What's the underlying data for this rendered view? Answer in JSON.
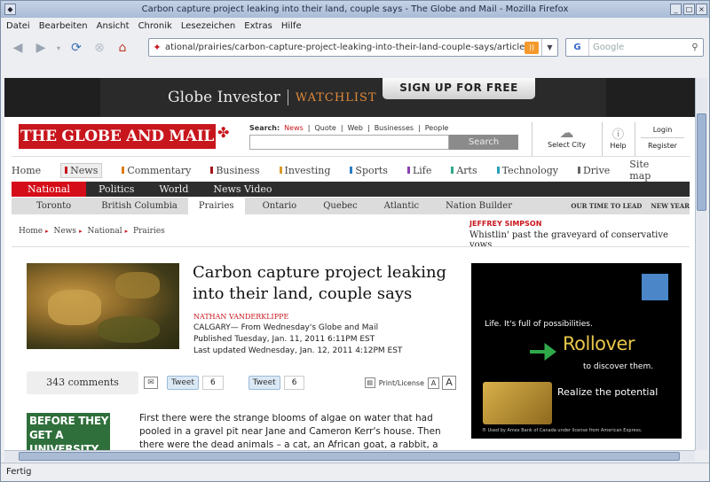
{
  "window": {
    "title": "Carbon capture project leaking into their land, couple says - The Globe and Mail - Mozilla Firefox"
  },
  "menu": [
    "Datei",
    "Bearbeiten",
    "Ansicht",
    "Chronik",
    "Lesezeichen",
    "Extras",
    "Hilfe"
  ],
  "url": "ational/prairies/carbon-capture-project-leaking-into-their-land-couple-says/article1866299/",
  "search_placeholder": "Google",
  "status": "Fertig",
  "ad_top": {
    "brand": "Globe Investor",
    "product": "WATCHLIST",
    "cta": "SIGN UP FOR FREE"
  },
  "site": {
    "logo": "THE GLOBE AND MAIL",
    "search_label": "Search:",
    "search_options": [
      "News",
      "Quote",
      "Web",
      "Businesses",
      "People"
    ],
    "search_button": "Search",
    "tools": {
      "city": "Select City",
      "help": "Help",
      "login": "Login",
      "register": "Register"
    }
  },
  "sections": [
    "Home",
    "News",
    "Commentary",
    "Business",
    "Investing",
    "Sports",
    "Life",
    "Arts",
    "Technology",
    "Drive",
    "Site map"
  ],
  "subnav": [
    "National",
    "Politics",
    "World",
    "News Video"
  ],
  "regions": [
    "Toronto",
    "British Columbia",
    "Prairies",
    "Ontario",
    "Quebec",
    "Atlantic",
    "Nation Builder"
  ],
  "regions_right": [
    "OUR TIME TO LEAD",
    "NEW YEAR"
  ],
  "breadcrumb": [
    "Home",
    "News",
    "National",
    "Prairies"
  ],
  "column": {
    "author": "JEFFREY SIMPSON",
    "headline": "Whistlin' past the graveyard of conservative vows"
  },
  "article": {
    "headline": "Carbon capture project leaking into their land, couple says",
    "author": "NATHAN VANDERKLIPPE",
    "dateline": "CALGARY— From Wednesday's Globe and Mail",
    "published": "Published Tuesday, Jan. 11, 2011 6:11PM EST",
    "updated": "Last updated Wednesday, Jan. 12, 2011 4:12PM EST",
    "comments": "343 comments",
    "tweet": "Tweet",
    "tweet_count": "6",
    "print": "Print/License",
    "small_a": "A",
    "big_a": "A",
    "body": "First there were the strange blooms of algae on water that had pooled in a gravel pit near Jane and Cameron Kerr's house. Then there were the dead animals – a cat, an African goat, a rabbit, a duck, a half-dozen"
  },
  "promo": "BEFORE THEY GET A UNIVERSITY",
  "ad": {
    "line1": "Life. It's full of possibilities.",
    "rollover": "Rollover",
    "discover": "to discover them.",
    "realize": "Realize the potential",
    "fine": "® Used by Amex Bank of Canada under license from American Express."
  },
  "colors": {
    "brand_red": "#c8161d",
    "subnav_bg": "#2d2d2d"
  }
}
